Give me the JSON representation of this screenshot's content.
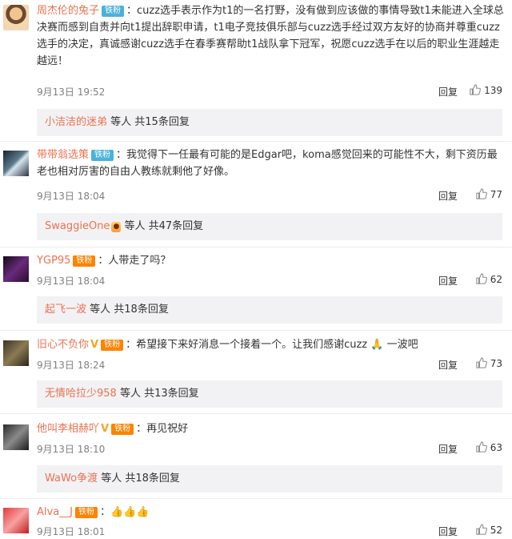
{
  "comments": [
    {
      "user": "周杰伦的兔子",
      "badge": "铁粉",
      "text": "：cuzz选手表示作为t1的一名打野，没有做到应该做的事情导致t1未能进入全球总决赛而感到自责并向t1提出辞职申请，t1电子竞技俱乐部与cuzz选手经过双方友好的协商并尊重cuzz选手的决定，真诚感谢cuzz选手在春季赛帮助t1战队拿下冠军，祝愿cuzz选手在以后的职业生涯越走越远！",
      "time": "9月13日 19:52",
      "reply": "回复",
      "likes": "139",
      "sub": {
        "user": "小洁洁的迷弟",
        "rest": "等人 共15条回复"
      }
    },
    {
      "user": "带带翁选策",
      "badge": "铁粉",
      "text": "：我觉得下一任最有可能的是Edgar吧，koma感觉回来的可能性不大，剩下资历最老也相对厉害的自由人教练就剩他了好像。",
      "time": "9月13日 18:04",
      "reply": "回复",
      "likes": "77",
      "sub": {
        "user": "SwaggieOne",
        "rest": "等人 共47条回复"
      }
    },
    {
      "user": "YGP95",
      "badge": "铁粉",
      "text": "：人带走了吗？",
      "time": "9月13日 18:04",
      "reply": "回复",
      "likes": "62",
      "sub": {
        "user": "起飞一波",
        "rest": "等人 共18条回复"
      }
    },
    {
      "user": "旧心不负你",
      "badge": "铁粉",
      "text": "：希望接下来好消息一个接着一个。让我们感谢cuzz 🙏 一波吧",
      "time": "9月13日 18:24",
      "reply": "回复",
      "likes": "73",
      "sub": {
        "user": "无情哈拉少958",
        "rest": "等人 共13条回复"
      }
    },
    {
      "user": "他叫李相赫吖",
      "badge": "铁粉",
      "text": "：再见祝好",
      "time": "9月13日 18:10",
      "reply": "回复",
      "likes": "63",
      "sub": {
        "user": "WaWo争渡",
        "rest": "等人 共18条回复"
      }
    },
    {
      "user": "Alva__J",
      "badge": "铁粉",
      "text": "：👍👍👍",
      "time": "9月13日 18:01",
      "reply": "回复",
      "likes": "52"
    }
  ],
  "colors": {
    "username": "#eb7350",
    "badge_blue": "#49b2de",
    "badge_fan": "#ff8200"
  },
  "icons": {
    "like": "thumbs-up-icon",
    "verified": "v-icon"
  }
}
